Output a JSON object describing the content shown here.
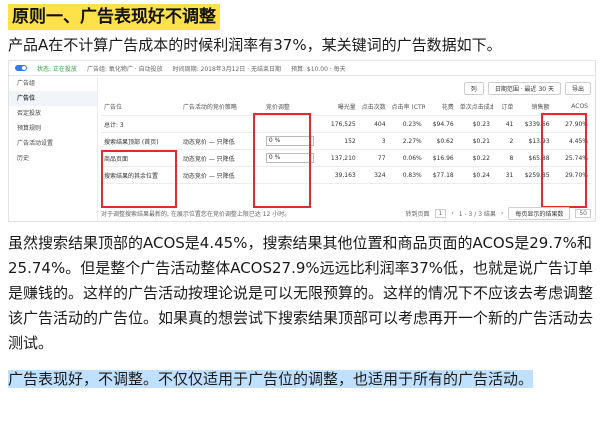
{
  "heading": "原则一、广告表现好不调整",
  "intro": "产品A在不计算广告成本的时候利润率有37%，某关键词的广告数据如下。",
  "screenshot": {
    "topbar": [
      "状态: 正在投放",
      "广告组: 氧化物广 · 自动投放",
      "时间周期: 2018年3月12日 · 无结束日期",
      "预算: $10.00 · 每天"
    ],
    "sidebar": [
      "广告组",
      "广告位",
      "否定投放",
      "预算规则",
      "广告活动设置",
      "历史"
    ],
    "tools": [
      "列",
      "日期范围 · 最近 30 天",
      "导出"
    ],
    "headers": [
      "广告位",
      "广告活动的竞价策略",
      "竞价调整",
      "曝光量",
      "点击次数",
      "点击率 (CTR)",
      "花费",
      "单次点击成本",
      "订单",
      "销售额",
      "ACOS"
    ],
    "rows": [
      [
        "总计: 3",
        "",
        "",
        "176,525",
        "404",
        "0.23%",
        "$94.76",
        "$0.23",
        "41",
        "$339.66",
        "27.90%"
      ],
      [
        "搜索结果顶部 (首页)",
        "动态竞价 — 只降低",
        "0 %",
        "152",
        "3",
        "2.27%",
        "$0.62",
        "$0.21",
        "2",
        "$13.93",
        "4.45%"
      ],
      [
        "商品页面",
        "动态竞价 — 只降低",
        "0 %",
        "137,210",
        "77",
        "0.06%",
        "$16.96",
        "$0.22",
        "8",
        "$65.88",
        "25.74%"
      ],
      [
        "搜索结果的其余位置",
        "动态竞价 — 只降低",
        "",
        "39,163",
        "324",
        "0.83%",
        "$77.18",
        "$0.24",
        "31",
        "$259.85",
        "29.70%"
      ]
    ],
    "footer_note": "对于调整搜索结果最新的, 在展示位置您在竞价调整上限已达 12 小时。",
    "footer_goto": "转到页面",
    "footer_page": "1",
    "footer_range": "1 - 3 / 3 结果",
    "footer_per_page_label": "每页显示的结果数",
    "footer_per_page": "50"
  },
  "analysis": "虽然搜索结果顶部的ACOS是4.45%，搜索结果其他位置和商品页面的ACOS是29.7%和25.74%。但是整个广告活动整体ACOS27.9%远远比利润率37%低，也就是说广告订单是赚钱的。这样的广告活动按理论说是可以无限预算的。这样的情况下不应该去考虑调整该广告活动的广告位。如果真的想尝试下搜索结果顶部可以考虑再开一个新的广告活动去测试。",
  "conclusion": "广告表现好，不调整。不仅仅适用于广告位的调整，也适用于所有的广告活动。",
  "colors": {
    "highlight_yellow": "#ffe24a",
    "highlight_blue": "#bfe0ff",
    "annotation_red": "#e52a2a"
  }
}
